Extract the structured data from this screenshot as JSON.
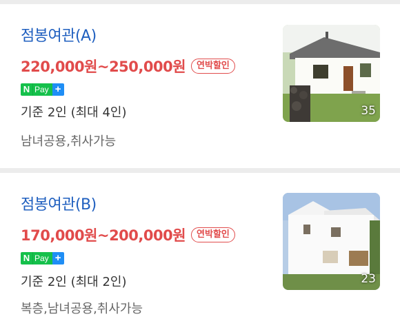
{
  "listings": [
    {
      "title": "점봉여관(A)",
      "price": "220,000원~250,000원",
      "badge": "연박할인",
      "npay": {
        "n": "N",
        "pay": "Pay",
        "plus": "+"
      },
      "capacity": "기준 2인 (최대 4인)",
      "features": "남녀공용,취사가능",
      "photo_count": "35"
    },
    {
      "title": "점봉여관(B)",
      "price": "170,000원~200,000원",
      "badge": "연박할인",
      "npay": {
        "n": "N",
        "pay": "Pay",
        "plus": "+"
      },
      "capacity": "기준 2인 (최대 2인)",
      "features": "복층,남녀공용,취사가능",
      "photo_count": "23"
    }
  ],
  "colors": {
    "title": "#1f5fbf",
    "price": "#e14b4b",
    "npay_green": "#15c04b",
    "npay_blue": "#1f8ef5"
  }
}
